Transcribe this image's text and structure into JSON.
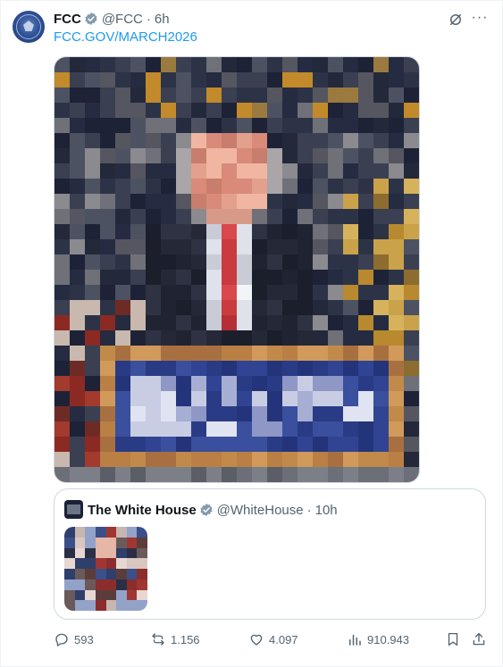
{
  "tweet": {
    "author_name": "FCC",
    "handle": "@FCC",
    "separator": "·",
    "time": "6h",
    "link_text": "FCC.GOV/MARCH2026"
  },
  "quoted": {
    "author_name": "The White House",
    "handle": "@WhiteHouse",
    "separator": "·",
    "time": "10h"
  },
  "actions": {
    "replies": "593",
    "reposts": "1.156",
    "likes": "4.097",
    "views": "910.943"
  },
  "colors": {
    "link": "#1d9bf0",
    "verified": "#829aab",
    "muted": "#536471"
  },
  "icons": [
    "verified-badge-icon",
    "grok-icon",
    "more-icon",
    "reply-icon",
    "repost-icon",
    "like-icon",
    "views-icon",
    "bookmark-icon",
    "share-icon"
  ]
}
